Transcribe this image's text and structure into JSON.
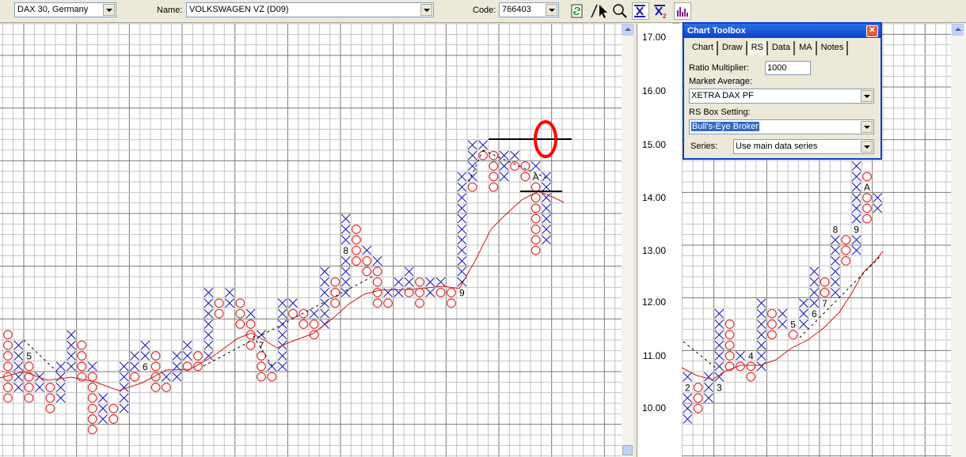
{
  "toolbar": {
    "index_select": "DAX 30, Germany",
    "name_label": "Name:",
    "name_select": "VOLKSWAGEN VZ (D09)",
    "code_label": "Code:",
    "code_select": "766403",
    "buttons": [
      "refresh-icon",
      "draw-line-icon",
      "pointer-icon",
      "zoom-icon",
      "x1-icon",
      "x2-icon",
      "bar-chart-icon"
    ]
  },
  "colors": {
    "x_mark": "#1c1cb4",
    "o_mark": "#e02424",
    "moving_average": "#d01818",
    "highlight": "#ff0000"
  },
  "axis": {
    "labels": [
      "17.00",
      "16.00",
      "15.00",
      "14.00",
      "13.00",
      "12.00",
      "11.00",
      "10.00"
    ]
  },
  "toolbox": {
    "title": "Chart Toolbox",
    "close": "✕",
    "tabs": [
      "Chart",
      "Draw",
      "RS",
      "Data",
      "MA",
      "Notes"
    ],
    "active_tab": "RS",
    "ratio_multiplier_label": "Ratio Multiplier:",
    "ratio_multiplier_value": "1000",
    "market_average_label": "Market Average:",
    "market_average_value": "XETRA DAX PF",
    "rs_box_label": "RS Box Setting:",
    "rs_box_value": "Bull's-Eye Broker",
    "series_label": "Series:",
    "series_value": "Use main data series"
  },
  "chart_data": [
    {
      "type": "point-and-figure",
      "name": "price chart (left)",
      "columns": [
        {
          "x": [],
          "o": [
            5,
            11
          ]
        },
        {
          "x": [
            6,
            10
          ],
          "o": []
        },
        {
          "x": [],
          "o": [
            5,
            8
          ]
        },
        {
          "x": [
            6,
            7
          ],
          "o": []
        },
        {
          "x": [],
          "o": [
            4,
            6
          ]
        },
        {
          "x": [
            5,
            8
          ],
          "o": []
        },
        {
          "x": [
            8,
            11
          ],
          "o": []
        },
        {
          "x": [],
          "o": [
            7,
            10
          ]
        },
        {
          "x": [
            8,
            8
          ],
          "o": [
            2,
            7
          ]
        },
        {
          "x": [
            3,
            5
          ],
          "o": []
        },
        {
          "x": [],
          "o": [
            3,
            4
          ]
        },
        {
          "x": [
            4,
            8
          ],
          "o": []
        },
        {
          "x": [
            8,
            9
          ],
          "o": [
            7,
            7
          ]
        },
        {
          "x": [
            9,
            10
          ],
          "o": []
        },
        {
          "x": [],
          "o": [
            6,
            9
          ]
        },
        {
          "x": [
            7,
            7
          ],
          "o": [
            6,
            6
          ]
        },
        {
          "x": [
            7,
            9
          ],
          "o": []
        },
        {
          "x": [
            9,
            10
          ],
          "o": [
            8,
            8
          ]
        },
        {
          "x": [],
          "o": [
            8,
            9
          ]
        },
        {
          "x": [
            9,
            15
          ],
          "o": []
        },
        {
          "x": [],
          "o": [
            13,
            14
          ]
        },
        {
          "x": [
            14,
            15
          ],
          "o": []
        },
        {
          "x": [],
          "o": [
            12,
            14
          ]
        },
        {
          "x": [
            13,
            13
          ],
          "o": [
            10,
            12
          ]
        },
        {
          "x": [
            11,
            11
          ],
          "o": [
            7,
            9
          ]
        },
        {
          "x": [
            8,
            8
          ],
          "o": [
            7,
            7
          ]
        },
        {
          "x": [
            8,
            14
          ],
          "o": []
        },
        {
          "x": [
            14,
            14
          ],
          "o": [
            13,
            13
          ]
        },
        {
          "x": [],
          "o": [
            12,
            13
          ]
        },
        {
          "x": [
            13,
            13
          ],
          "o": [
            11,
            12
          ]
        },
        {
          "x": [
            12,
            17
          ],
          "o": []
        },
        {
          "x": [],
          "o": [
            14,
            16
          ]
        },
        {
          "x": [
            15,
            22
          ],
          "o": [],
          "skip": [
            19
          ]
        },
        {
          "x": [],
          "o": [
            18,
            21
          ]
        },
        {
          "x": [
            19,
            19
          ],
          "o": [
            17,
            18
          ]
        },
        {
          "x": [
            18,
            18
          ],
          "o": [
            14,
            17
          ]
        },
        {
          "x": [
            15,
            15
          ],
          "o": [
            14,
            14
          ]
        },
        {
          "x": [
            15,
            16
          ],
          "o": []
        },
        {
          "x": [
            16,
            17
          ],
          "o": [
            15,
            15
          ]
        },
        {
          "x": [],
          "o": [
            14,
            16
          ]
        },
        {
          "x": [
            15,
            16
          ],
          "o": []
        },
        {
          "x": [
            16,
            16
          ],
          "o": [
            15,
            15
          ]
        },
        {
          "x": [],
          "o": [
            14,
            15
          ]
        },
        {
          "x": [
            16,
            26
          ],
          "o": []
        },
        {
          "x": [
            26,
            29
          ],
          "o": [
            25,
            25
          ]
        },
        {
          "x": [
            29,
            29
          ],
          "o": [
            28,
            28
          ]
        },
        {
          "x": [],
          "o": [
            25,
            28
          ]
        },
        {
          "x": [
            26,
            28
          ],
          "o": []
        },
        {
          "x": [
            28,
            28
          ],
          "o": [
            27,
            27
          ]
        },
        {
          "x": [],
          "o": [
            26,
            27
          ]
        },
        {
          "x": [
            27,
            27
          ],
          "o": [
            19,
            25
          ]
        },
        {
          "x": [
            20,
            26
          ],
          "o": []
        }
      ],
      "month_labels": [
        {
          "col": 2,
          "level": 9,
          "text": "5"
        },
        {
          "col": 13,
          "level": 8,
          "text": "6"
        },
        {
          "col": 24,
          "level": 10,
          "text": "7"
        },
        {
          "col": 32,
          "level": 19,
          "text": "8"
        },
        {
          "col": 43,
          "level": 15,
          "text": "9"
        },
        {
          "col": 50,
          "level": 26,
          "text": "A"
        }
      ]
    },
    {
      "type": "point-and-figure",
      "name": "relative strength chart (right)",
      "box_size": 0.2,
      "y_range": [
        10.0,
        17.0
      ],
      "columns": [
        {
          "x": [
            9.6,
            10.4
          ],
          "o": [],
          "skip": [
            10.2
          ]
        },
        {
          "x": [],
          "o": [
            9.8,
            10.2
          ]
        },
        {
          "x": [
            10.0,
            10.4
          ],
          "o": []
        },
        {
          "x": [
            10.4,
            11.6
          ],
          "o": []
        },
        {
          "x": [],
          "o": [
            10.6,
            11.4
          ]
        },
        {
          "x": [
            10.8,
            10.8
          ],
          "o": [
            10.6,
            10.6
          ]
        },
        {
          "x": [],
          "o": [
            10.4,
            10.6
          ]
        },
        {
          "x": [
            10.6,
            11.8
          ],
          "o": []
        },
        {
          "x": [],
          "o": [
            11.2,
            11.6
          ]
        },
        {
          "x": [
            11.4,
            11.6
          ],
          "o": []
        },
        {
          "x": [],
          "o": [
            11.2,
            11.2
          ]
        },
        {
          "x": [
            11.4,
            11.8
          ],
          "o": []
        },
        {
          "x": [
            11.8,
            12.4
          ],
          "o": []
        },
        {
          "x": [],
          "o": [
            12.0,
            12.2
          ]
        },
        {
          "x": [
            12.0,
            13.0
          ],
          "o": []
        },
        {
          "x": [],
          "o": [
            12.6,
            13.0
          ]
        },
        {
          "x": [
            12.8,
            14.4
          ],
          "o": [],
          "skip": [
            13.2
          ]
        },
        {
          "x": [],
          "o": [
            13.4,
            14.2
          ],
          "skip": [
            14.0
          ]
        },
        {
          "x": [
            13.6,
            13.8
          ],
          "o": []
        }
      ],
      "month_labels": [
        {
          "col": 0,
          "price": 10.2,
          "text": "2"
        },
        {
          "col": 3,
          "price": 10.2,
          "text": "3"
        },
        {
          "col": 6,
          "price": 10.8,
          "text": "4"
        },
        {
          "col": 10,
          "price": 11.4,
          "text": "5"
        },
        {
          "col": 12,
          "price": 11.6,
          "text": "6"
        },
        {
          "col": 13,
          "price": 11.8,
          "text": "7"
        },
        {
          "col": 14,
          "price": 13.2,
          "text": "8"
        },
        {
          "col": 16,
          "price": 13.2,
          "text": "9"
        },
        {
          "col": 17,
          "price": 14.0,
          "text": "A"
        }
      ]
    }
  ]
}
